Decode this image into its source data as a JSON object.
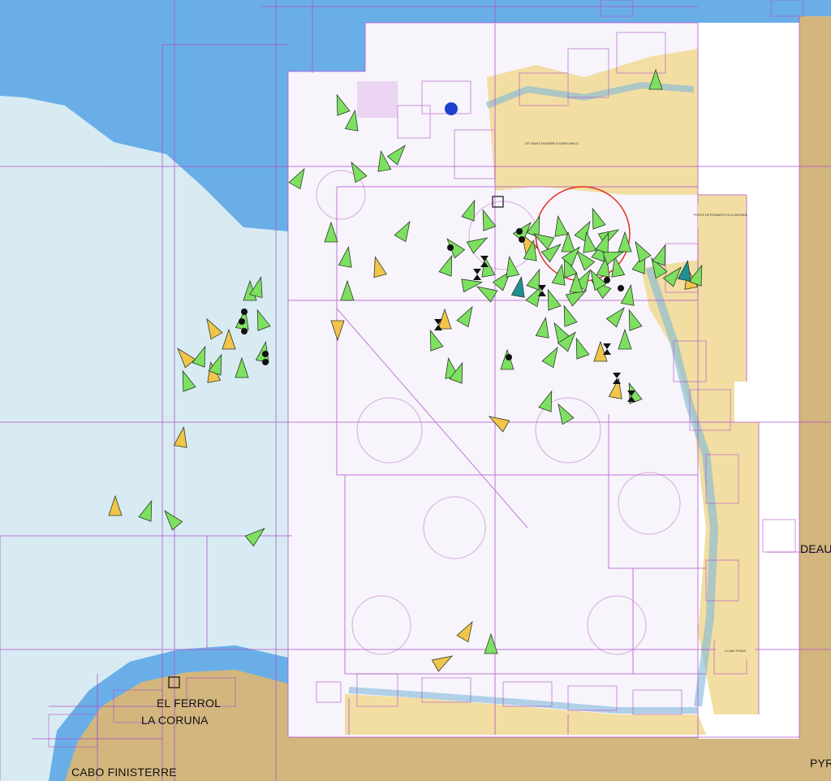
{
  "colors": {
    "deep_water": "#6aaee8",
    "shallow_water": "#d8ebf3",
    "land": "#d2b67e",
    "chart_paper": "#f7f4fb",
    "chart_land": "#f2dea3",
    "grid_lines": "#b04ccc",
    "vessel_green": "#7ee060",
    "vessel_yellow": "#f2c44a",
    "vessel_teal": "#1f8f8f",
    "highlight_circle": "#e03020"
  },
  "labels": {
    "el_ferrol": "EL FERROL",
    "la_coruna": "LA CORUNA",
    "cabo_finisterre": "CABO FINISTERRE",
    "bordeaux_partial": "DEAUX",
    "pyrenees_partial": "PYR"
  },
  "chart_titles": {
    "north_chart": "DE SAINT-NAZAIRE A SAINT-MALO",
    "east_chart": "POINTE DE PENMARC'H A LA GIRONDE",
    "south_chart": "A CABO PENAS"
  },
  "icons": {
    "vessel": "triangle-vessel-icon",
    "anchored": "anchored-vessel-icon",
    "waypoint": "waypoint-icon",
    "aid_to_navigation": "blue-buoy-icon",
    "area_circle": "area-circle-icon"
  }
}
